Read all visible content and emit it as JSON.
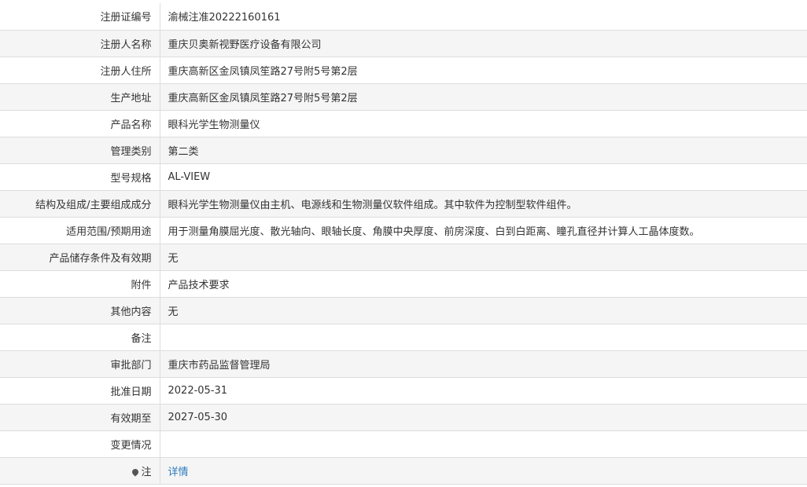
{
  "rows": [
    {
      "label": "注册证编号",
      "value": "渝械注准20222160161"
    },
    {
      "label": "注册人名称",
      "value": "重庆贝奥新视野医疗设备有限公司"
    },
    {
      "label": "注册人住所",
      "value": "重庆高新区金凤镇凤笙路27号附5号第2层"
    },
    {
      "label": "生产地址",
      "value": "重庆高新区金凤镇凤笙路27号附5号第2层"
    },
    {
      "label": "产品名称",
      "value": "眼科光学生物测量仪"
    },
    {
      "label": "管理类别",
      "value": "第二类"
    },
    {
      "label": "型号规格",
      "value": "AL-VIEW"
    },
    {
      "label": "结构及组成/主要组成成分",
      "value": "眼科光学生物测量仪由主机、电源线和生物测量仪软件组成。其中软件为控制型软件组件。"
    },
    {
      "label": "适用范围/预期用途",
      "value": "用于测量角膜屈光度、散光轴向、眼轴长度、角膜中央厚度、前房深度、白到白距离、瞳孔直径并计算人工晶体度数。"
    },
    {
      "label": "产品储存条件及有效期",
      "value": "无"
    },
    {
      "label": "附件",
      "value": "产品技术要求"
    },
    {
      "label": "其他内容",
      "value": "无"
    },
    {
      "label": "备注",
      "value": ""
    },
    {
      "label": "审批部门",
      "value": "重庆市药品监督管理局"
    },
    {
      "label": "批准日期",
      "value": "2022-05-31"
    },
    {
      "label": "有效期至",
      "value": "2027-05-30"
    },
    {
      "label": "变更情况",
      "value": ""
    }
  ],
  "note": {
    "icon": "pin-icon",
    "label": "注",
    "link_text": "详情"
  },
  "colors": {
    "row_alt": "#f5f5f5",
    "border": "#dddddd",
    "link": "#2b7bc0"
  }
}
